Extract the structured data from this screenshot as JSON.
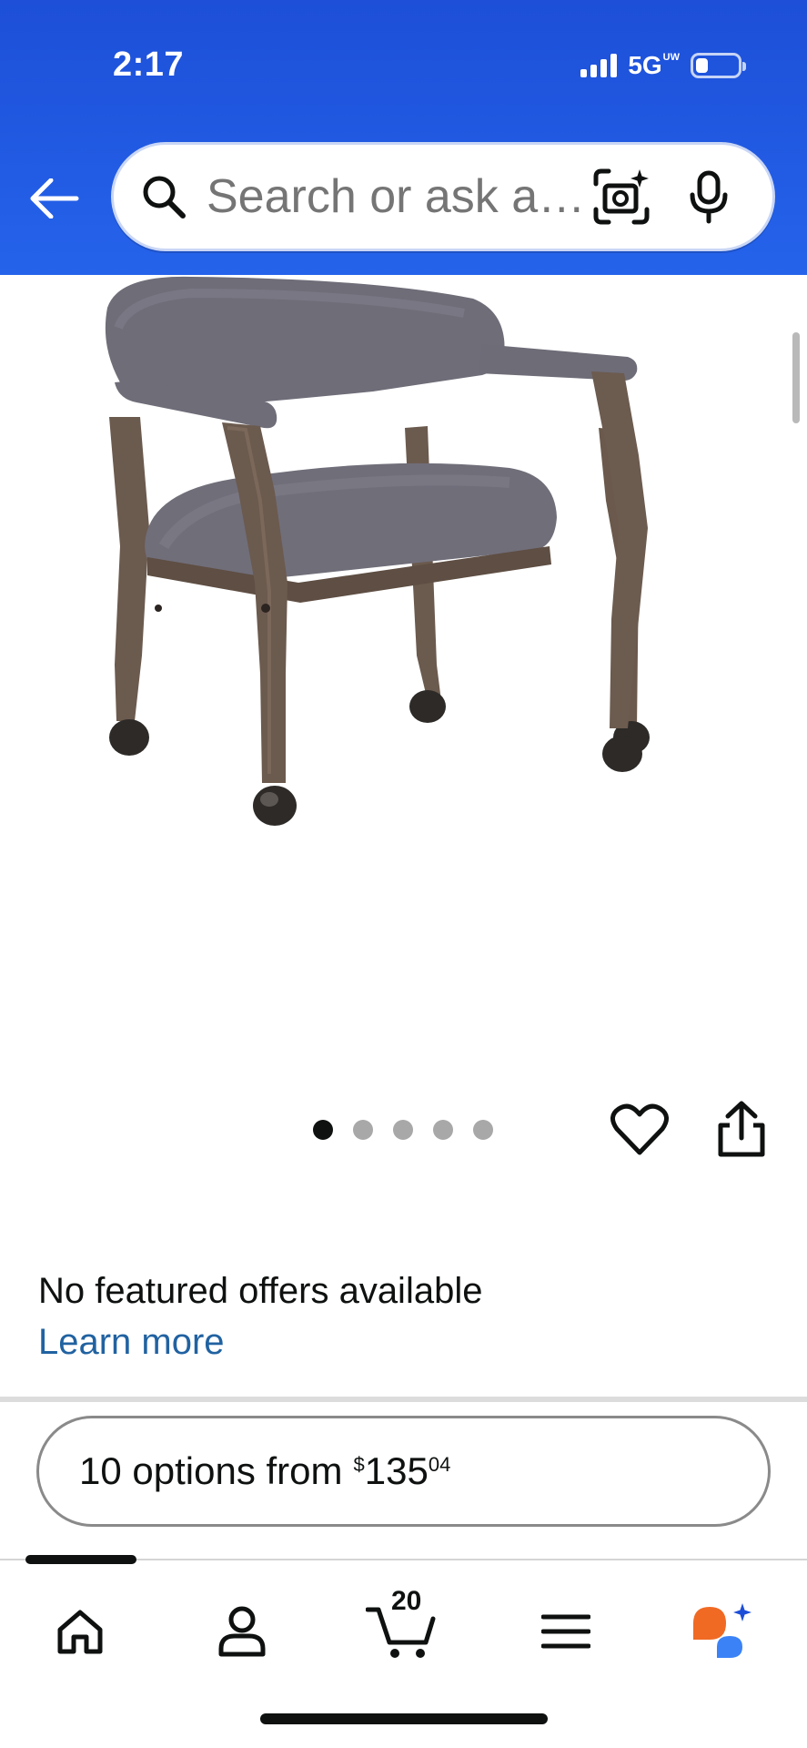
{
  "status_bar": {
    "time": "2:17",
    "network": "5G",
    "network_superscript": "UW",
    "battery_level": 0.3
  },
  "header": {
    "search_placeholder": "Search or ask a qu…",
    "back_icon": "arrow-left-icon",
    "search_icon": "search-icon",
    "lens_icon": "camera-lens-icon",
    "mic_icon": "microphone-icon",
    "brand_color": "#2563eb"
  },
  "gallery": {
    "image_count": 5,
    "active_index": 0
  },
  "offers": {
    "no_offers_text": "No featured offers available",
    "learn_more_label": "Learn more",
    "link_color": "#2162a1"
  },
  "options_button": {
    "label": "10 options from",
    "currency": "$",
    "price_whole": "135",
    "price_fraction": "04"
  },
  "bottom_nav": {
    "cart_count": "20",
    "items": [
      "home-icon",
      "account-icon",
      "cart-icon",
      "menu-icon",
      "rufus-assistant-icon"
    ]
  }
}
